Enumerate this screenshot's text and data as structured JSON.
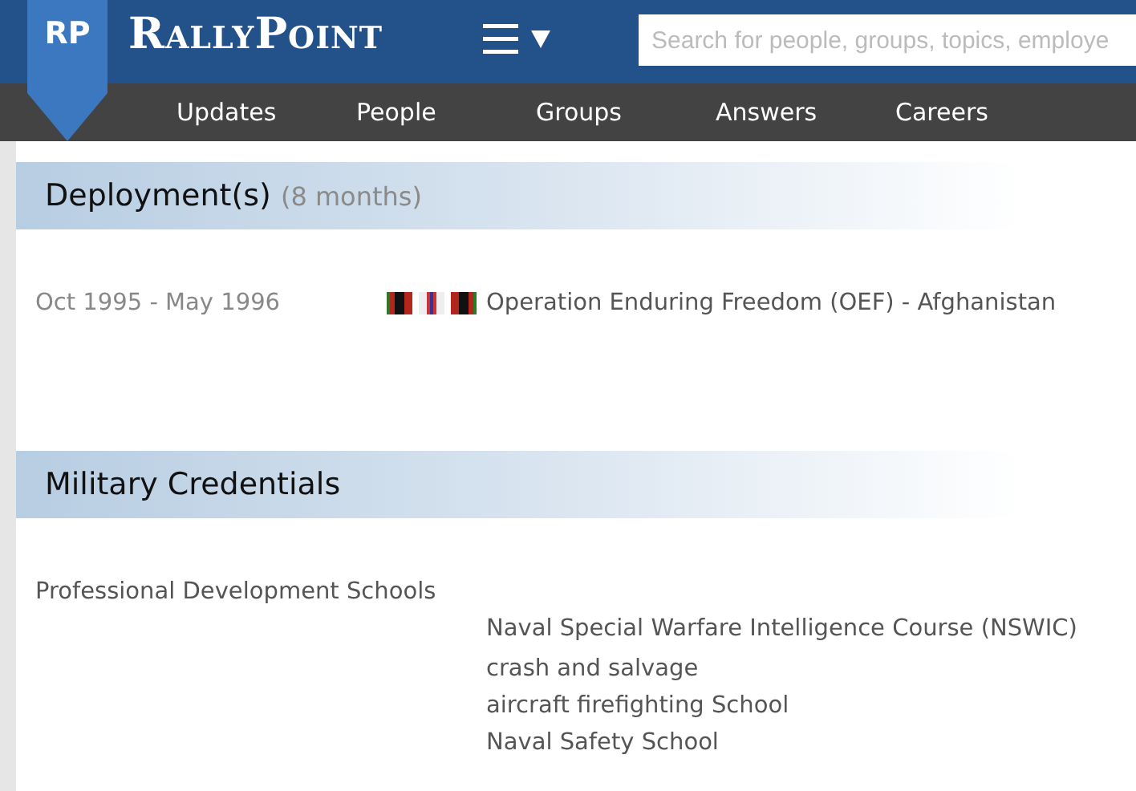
{
  "header": {
    "logo_badge": "RP",
    "logo_text": "RallyPoint",
    "search": {
      "placeholder": "Search for people, groups, topics, employe"
    }
  },
  "nav": [
    "Updates",
    "People",
    "Groups",
    "Answers",
    "Careers"
  ],
  "deployments": {
    "title": "Deployment(s)",
    "duration": "(8 months)",
    "items": [
      {
        "dates": "Oct 1995 - May 1996",
        "name": "Operation Enduring Freedom (OEF) - Afghanistan"
      }
    ]
  },
  "credentials": {
    "title": "Military Credentials",
    "groups": [
      {
        "label": "Professional Development Schools",
        "items": [
          "Naval Special Warfare Intelligence Course (NSWIC)",
          "crash and salvage",
          "aircraft firefighting School",
          "Naval Safety School"
        ]
      }
    ]
  }
}
